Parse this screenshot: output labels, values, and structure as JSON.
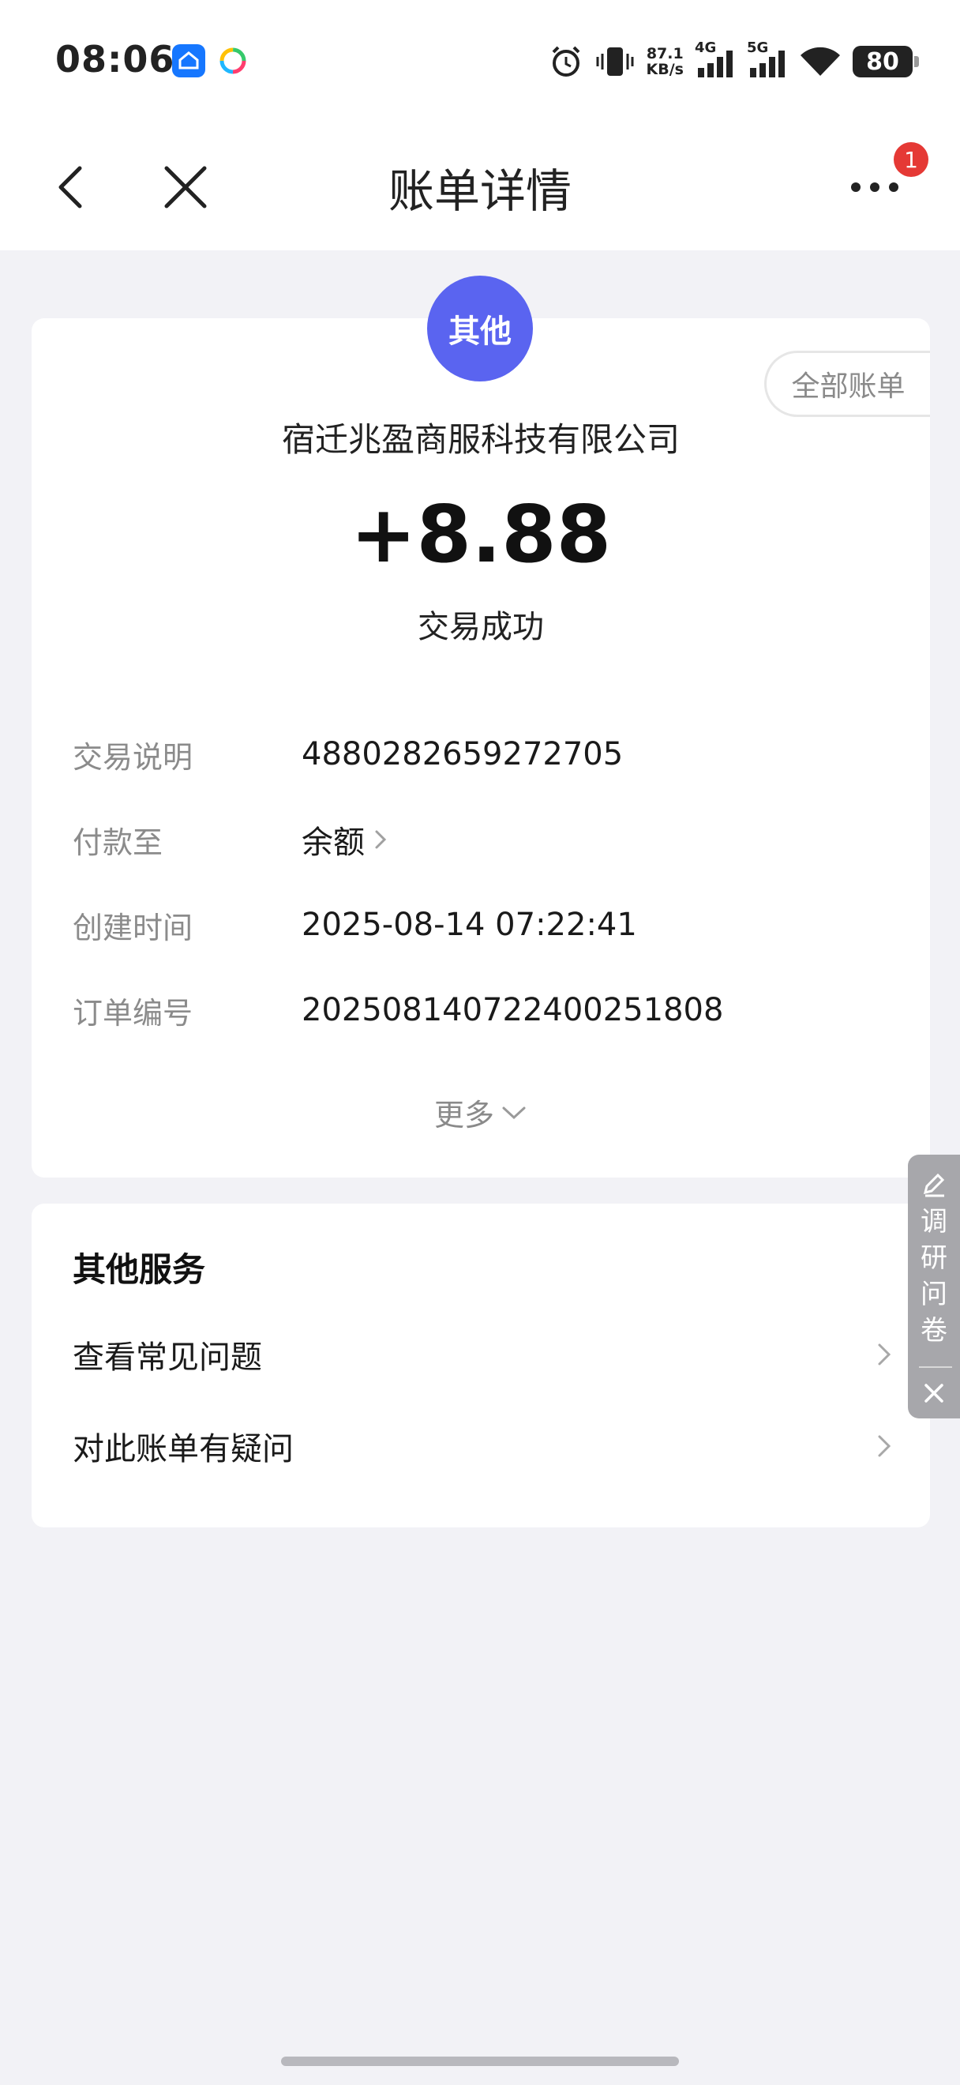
{
  "status_bar": {
    "time": "08:06",
    "net_speed_value": "87.1",
    "net_speed_unit": "KB/s",
    "signal_1": "4G",
    "signal_2": "5G",
    "battery": "80"
  },
  "nav": {
    "title": "账单详情",
    "notification_count": "1"
  },
  "bill": {
    "category_avatar": "其他",
    "all_bills_button": "全部账单",
    "merchant": "宿迁兆盈商服科技有限公司",
    "amount": "+8.88",
    "status": "交易成功",
    "details": [
      {
        "label": "交易说明",
        "value": "4880282659272705"
      },
      {
        "label": "付款至",
        "value": "余额"
      },
      {
        "label": "创建时间",
        "value": "2025-08-14 07:22:41"
      },
      {
        "label": "订单编号",
        "value": "20250814072240025180​8"
      }
    ],
    "more": "更多"
  },
  "services": {
    "title": "其他服务",
    "items": [
      {
        "label": "查看常见问题"
      },
      {
        "label": "对此账单有疑问"
      }
    ]
  },
  "survey": {
    "label": "调研问卷"
  },
  "colors": {
    "accent": "#5a64f0",
    "badge": "#e53935",
    "background": "#f2f2f6"
  }
}
